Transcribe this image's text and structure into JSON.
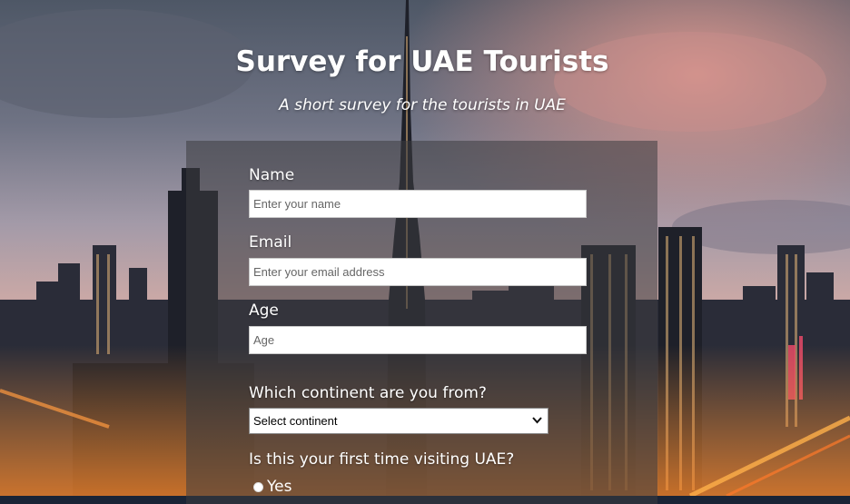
{
  "page": {
    "title": "Survey for UAE Tourists",
    "description": "A short survey for the tourists in UAE"
  },
  "form": {
    "name_label": "Name",
    "name_placeholder": "Enter your name",
    "email_label": "Email",
    "email_placeholder": "Enter your email address",
    "age_label": "Age",
    "age_placeholder": "Age",
    "continent_label": "Which continent are you from?",
    "continent_selected": "Select continent",
    "first_visit_label": "Is this your first time visiting UAE?",
    "first_visit_options": [
      "Yes"
    ]
  },
  "colors": {
    "panel": "rgba(60,60,64,0.55)",
    "text": "#ffffff"
  },
  "icons": {
    "select_arrow": "chevron-down-icon"
  }
}
